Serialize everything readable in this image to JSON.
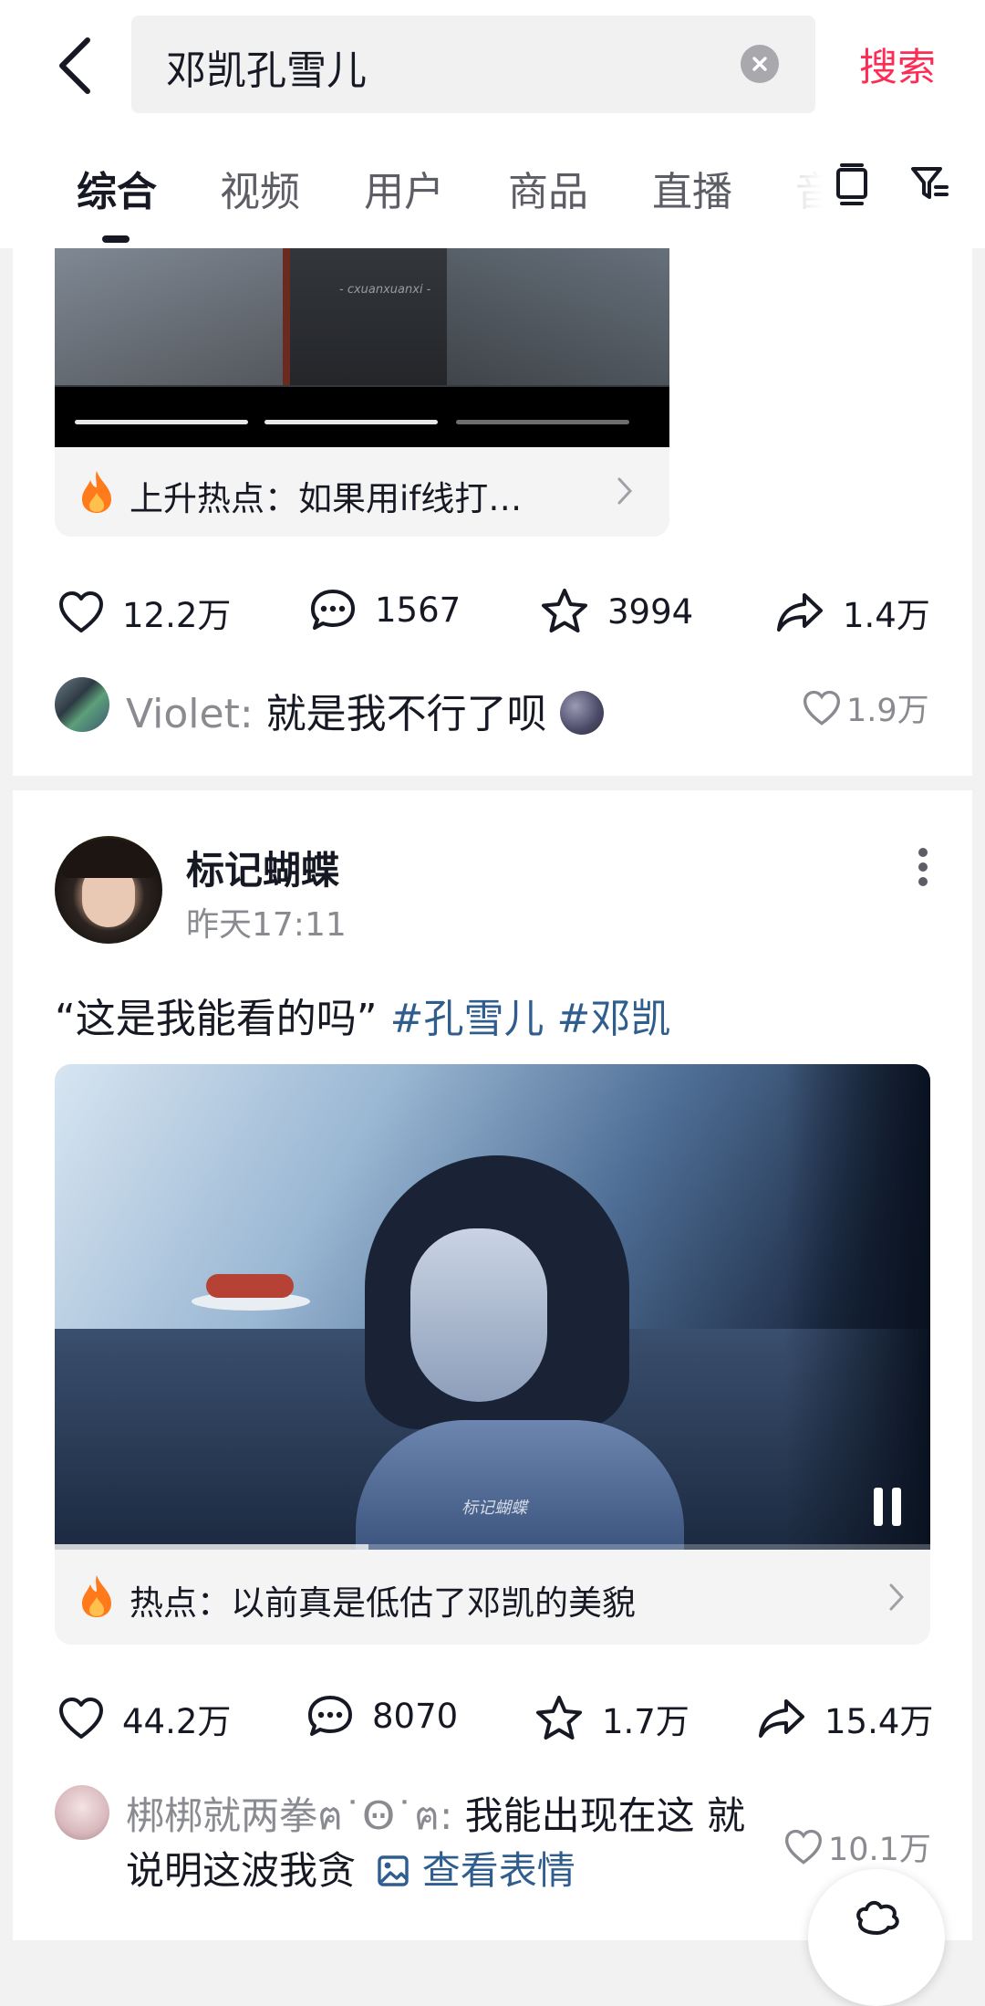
{
  "header": {
    "search_query": "邓凯孔雪儿",
    "search_button": "搜索",
    "tabs": [
      "综合",
      "视频",
      "用户",
      "商品",
      "直播",
      "音"
    ]
  },
  "post1": {
    "video_watermark": "- cxuanxuanxi -",
    "hot_label": "上升热点：如果用if线打…",
    "stats": {
      "likes": "12.2万",
      "comments": "1567",
      "favorites": "3994",
      "shares": "1.4万"
    },
    "comment": {
      "user": "Violet:",
      "text": "就是我不行了呗",
      "likes": "1.9万"
    }
  },
  "post2": {
    "author": "标记蝴蝶",
    "time": "昨天17:11",
    "caption": "“这是我能看的吗”",
    "hashtags": [
      "#孔雪儿",
      "#邓凯"
    ],
    "video_watermark": "标记蝴蝶",
    "hot_label": "热点：以前真是低估了邓凯的美貌",
    "stats": {
      "likes": "44.2万",
      "comments": "8070",
      "favorites": "1.7万",
      "shares": "15.4万"
    },
    "comment": {
      "user": "梆梆就两拳ฅ˙Ꙫ˙ฅ:",
      "text_line1": "我能出现在这 就",
      "text_line2": "说明这波我贪",
      "sticker_link": "查看表情",
      "likes": "10.1万"
    }
  },
  "colors": {
    "accent": "#fe2c55",
    "hashtag": "#2f5d8e",
    "flame": "#ff7a1a"
  }
}
